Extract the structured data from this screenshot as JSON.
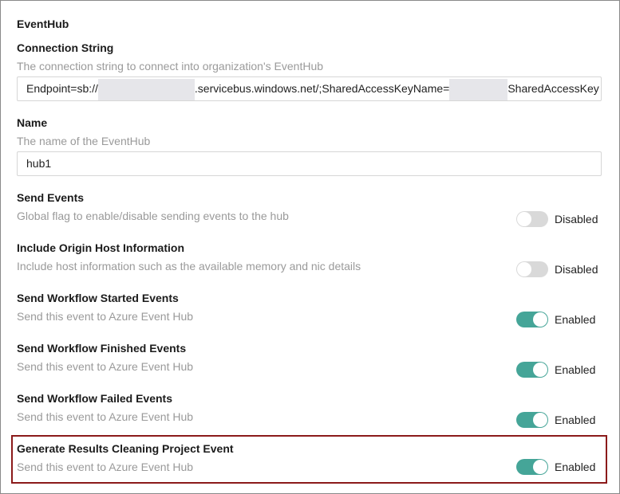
{
  "section_title": "EventHub",
  "connection_string": {
    "label": "Connection String",
    "description": "The connection string to connect into organization's EventHub",
    "value_prefix": "Endpoint=sb://",
    "value_middle": ".servicebus.windows.net/;SharedAccessKeyName=",
    "value_suffix": "SharedAccessKey"
  },
  "name": {
    "label": "Name",
    "description": "The name of the EventHub",
    "value": "hub1"
  },
  "settings": [
    {
      "label": "Send Events",
      "description": "Global flag to enable/disable sending events to the hub",
      "enabled": false,
      "state": "Disabled"
    },
    {
      "label": "Include Origin Host Information",
      "description": "Include host information such as the available memory and nic details",
      "enabled": false,
      "state": "Disabled"
    },
    {
      "label": "Send Workflow Started Events",
      "description": "Send this event to Azure Event Hub",
      "enabled": true,
      "state": "Enabled"
    },
    {
      "label": "Send Workflow Finished Events",
      "description": "Send this event to Azure Event Hub",
      "enabled": true,
      "state": "Enabled"
    },
    {
      "label": "Send Workflow Failed Events",
      "description": "Send this event to Azure Event Hub",
      "enabled": true,
      "state": "Enabled"
    },
    {
      "label": "Generate Results Cleaning Project Event",
      "description": "Send this event to Azure Event Hub",
      "enabled": true,
      "state": "Enabled"
    }
  ],
  "colors": {
    "toggle_on": "#45a598",
    "toggle_off": "#d9d9d9",
    "highlight_border": "#8b1a1a"
  }
}
